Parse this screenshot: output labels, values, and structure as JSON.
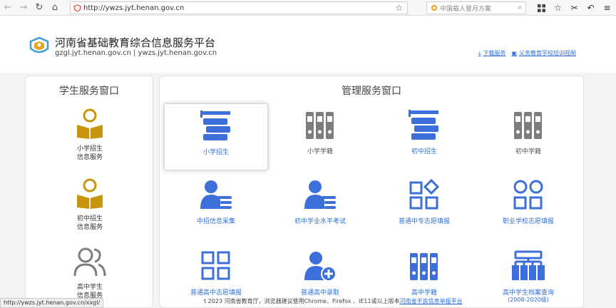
{
  "browser": {
    "url": "http://ywzs.jyt.henan.gov.cn",
    "search_placeholder": "中国载人登月方案"
  },
  "header": {
    "title": "河南省基础教育综合信息服务平台",
    "domains": "gzgl.jyt.henan.gov.cn | ywzs.jyt.henan.gov.cn",
    "link_download": "下载服务",
    "link_training": "义务教育学校培训视频"
  },
  "student_panel": {
    "title": "学生服务窗口",
    "items": [
      {
        "line1": "小学招生",
        "line2": "信息服务"
      },
      {
        "line1": "初中招生",
        "line2": "信息服务"
      },
      {
        "line1": "高中学生",
        "line2": "信息服务"
      }
    ]
  },
  "admin_panel": {
    "title": "管理服务窗口",
    "tiles": [
      {
        "label": "小学招生"
      },
      {
        "label": "小学学籍"
      },
      {
        "label": "初中招生"
      },
      {
        "label": "初中学籍"
      },
      {
        "label": "中招信息采集"
      },
      {
        "label": "初中学业水平考试"
      },
      {
        "label": "普通中专志愿填报"
      },
      {
        "label": "职业学校志愿填报"
      },
      {
        "label": "普通高中志愿填报"
      },
      {
        "label": "普通高中录取"
      },
      {
        "label": "高中学籍"
      },
      {
        "label": "高中学生档案查询",
        "sub": "(2008-2020级)"
      }
    ]
  },
  "status_url": "http://ywzs.jyt.henan.gov.cn/xxgl/",
  "footer": {
    "text": "t 2023 河南省教育厅，浏览器建议使用Chrome、Firefox 、IE11或以上版本",
    "link": "河南省不良信息举报平台"
  },
  "colors": {
    "accent_blue": "#3c6fd9",
    "gold": "#c8960c",
    "gray_icon": "#7d7d7d"
  }
}
